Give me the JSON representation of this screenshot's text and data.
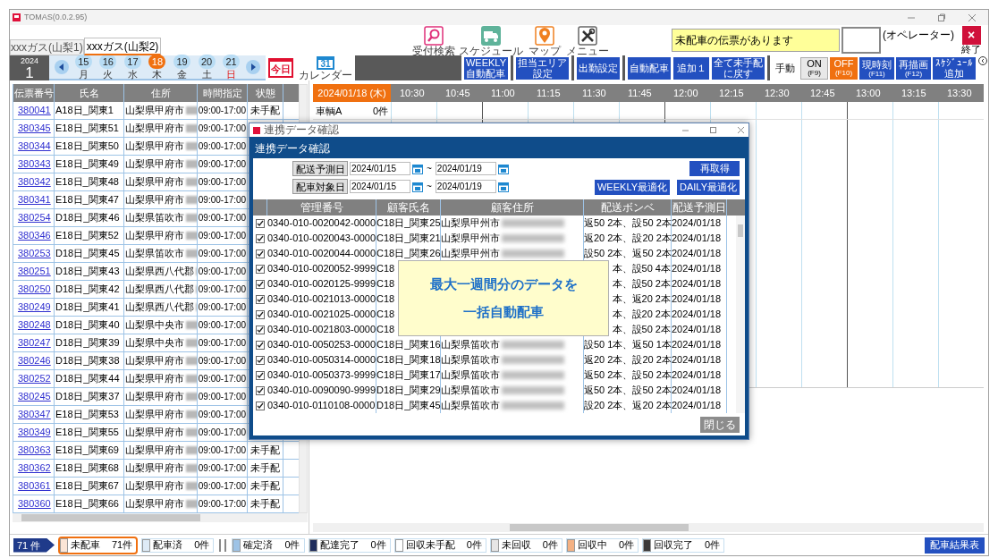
{
  "window": {
    "title": "TOMAS(0.0.2.95)"
  },
  "tabs": [
    {
      "label": "xxxガス(山梨1)",
      "selected": false
    },
    {
      "label": "xxxガス(山梨2)",
      "selected": true
    }
  ],
  "toolbar_icons": [
    {
      "kind": "search",
      "label": "受付検索"
    },
    {
      "kind": "schedule",
      "label": "スケジュール"
    },
    {
      "kind": "map",
      "label": "マップ"
    },
    {
      "kind": "menu",
      "label": "メニュー"
    }
  ],
  "notice": "未配車の伝票があります",
  "operator": "(オペレーター)",
  "exit": {
    "icon": "×",
    "label": "終了"
  },
  "calendar": {
    "year": "2024",
    "month": "1",
    "today": "今日",
    "calendar_day": "31",
    "calendar_label": "カレンダー",
    "days": [
      {
        "day": "15",
        "weekday": "月",
        "selected": false
      },
      {
        "day": "16",
        "weekday": "火",
        "selected": false
      },
      {
        "day": "17",
        "weekday": "水",
        "selected": false
      },
      {
        "day": "18",
        "weekday": "木",
        "selected": true
      },
      {
        "day": "19",
        "weekday": "金",
        "selected": false
      },
      {
        "day": "20",
        "weekday": "土",
        "selected": false
      },
      {
        "day": "21",
        "weekday": "日",
        "selected": false
      }
    ]
  },
  "action_groups": [
    [
      {
        "lines": [
          "WEEKLY",
          "自動配車"
        ]
      }
    ],
    [
      {
        "lines": [
          "担当エリア",
          "設定"
        ]
      }
    ],
    [
      {
        "lines": [
          "出勤設定"
        ]
      }
    ],
    [
      {
        "lines": [
          "自動配車"
        ]
      },
      {
        "lines": [
          "追加１"
        ]
      },
      {
        "lines": [
          "全て未手配",
          "に戻す"
        ]
      }
    ]
  ],
  "manual": {
    "label": "手動",
    "modes": [
      {
        "label": "ON",
        "key": "(F9)",
        "selected": false
      },
      {
        "label": "OFF",
        "key": "(F10)",
        "selected": true
      }
    ]
  },
  "tools": [
    {
      "lines": [
        "現時刻"
      ],
      "key": "(F11)"
    },
    {
      "lines": [
        "再描画"
      ],
      "key": "(F12)"
    },
    {
      "lines": [
        "ｽｹｼﾞｭｰﾙ",
        "追加"
      ]
    }
  ],
  "slips": {
    "columns": [
      "伝票番号",
      "氏名",
      "住所",
      "時間指定",
      "状態"
    ],
    "rows": [
      {
        "number": "380041",
        "name": "A18日_関東1",
        "address": "山梨県甲府市",
        "time": "09:00-17:00",
        "status": "未手配"
      },
      {
        "number": "380345",
        "name": "E18日_関東51",
        "address": "山梨県甲府市",
        "time": "09:00-17:00"
      },
      {
        "number": "380344",
        "name": "E18日_関東50",
        "address": "山梨県甲府市",
        "time": "09:00-17:00"
      },
      {
        "number": "380343",
        "name": "E18日_関東49",
        "address": "山梨県甲府市",
        "time": "09:00-17:00"
      },
      {
        "number": "380342",
        "name": "E18日_関東48",
        "address": "山梨県甲府市",
        "time": "09:00-17:00"
      },
      {
        "number": "380341",
        "name": "E18日_関東47",
        "address": "山梨県甲府市",
        "time": "09:00-17:00"
      },
      {
        "number": "380254",
        "name": "D18日_関東46",
        "address": "山梨県笛吹市",
        "time": "09:00-17:00"
      },
      {
        "number": "380346",
        "name": "E18日_関東52",
        "address": "山梨県甲府市",
        "time": "09:00-17:00"
      },
      {
        "number": "380253",
        "name": "D18日_関東45",
        "address": "山梨県笛吹市",
        "time": "09:00-17:00"
      },
      {
        "number": "380251",
        "name": "D18日_関東43",
        "address": "山梨県西八代郡",
        "time": "09:00-17:00"
      },
      {
        "number": "380250",
        "name": "D18日_関東42",
        "address": "山梨県西八代郡",
        "time": "09:00-17:00"
      },
      {
        "number": "380249",
        "name": "D18日_関東41",
        "address": "山梨県西八代郡",
        "time": "09:00-17:00"
      },
      {
        "number": "380248",
        "name": "D18日_関東40",
        "address": "山梨県中央市",
        "time": "09:00-17:00"
      },
      {
        "number": "380247",
        "name": "D18日_関東39",
        "address": "山梨県中央市",
        "time": "09:00-17:00"
      },
      {
        "number": "380246",
        "name": "D18日_関東38",
        "address": "山梨県甲府市",
        "time": "09:00-17:00"
      },
      {
        "number": "380252",
        "name": "D18日_関東44",
        "address": "山梨県甲府市",
        "time": "09:00-17:00"
      },
      {
        "number": "380245",
        "name": "D18日_関東37",
        "address": "山梨県甲府市",
        "time": "09:00-17:00"
      },
      {
        "number": "380347",
        "name": "E18日_関東53",
        "address": "山梨県甲府市",
        "time": "09:00-17:00"
      },
      {
        "number": "380349",
        "name": "E18日_関東55",
        "address": "山梨県甲府市",
        "time": "09:00-17:00"
      },
      {
        "number": "380363",
        "name": "E18日_関東69",
        "address": "山梨県甲府市",
        "time": "09:00-17:00",
        "status": "未手配"
      },
      {
        "number": "380362",
        "name": "E18日_関東68",
        "address": "山梨県甲府市",
        "time": "09:00-17:00",
        "status": "未手配"
      },
      {
        "number": "380361",
        "name": "E18日_関東67",
        "address": "山梨県甲府市",
        "time": "09:00-17:00",
        "status": "未手配"
      },
      {
        "number": "380360",
        "name": "E18日_関東66",
        "address": "山梨県甲府市",
        "time": "09:00-17:00",
        "status": "未手配"
      }
    ]
  },
  "timeline": {
    "date": "2024/01/18 (木)",
    "times": [
      "10:30",
      "10:45",
      "11:00",
      "11:15",
      "11:30",
      "11:45",
      "12:00",
      "12:15",
      "12:30",
      "12:45",
      "13:00",
      "13:15",
      "13:30"
    ],
    "vehicles": [
      {
        "name": "車輌A",
        "count": "0件"
      }
    ]
  },
  "dialog": {
    "title": "連携データ確認",
    "heading": "連携データ確認",
    "filters": [
      {
        "label": "配送予測日",
        "from": "2024/01/15",
        "separator": "~",
        "to": "2024/01/19"
      },
      {
        "label": "配車対象日",
        "from": "2024/01/15",
        "separator": "~",
        "to": "2024/01/19"
      }
    ],
    "buttons": {
      "refetch": "再取得",
      "weekly": "WEEKLY最適化",
      "daily": "DAILY最適化",
      "close": "閉じる"
    },
    "columns": [
      "管理番号",
      "顧客氏名",
      "顧客住所",
      "配送ボンベ",
      "配送予測日"
    ],
    "rows": [
      {
        "checked": true,
        "id": "0340-010-0020042-0000",
        "name": "C18日_関東25",
        "address": "山梨県甲州市",
        "cylinders": "返50 2本、設50 2本",
        "date": "2024/01/18"
      },
      {
        "checked": true,
        "id": "0340-010-0020043-0000",
        "name": "C18日_関東21",
        "address": "山梨県甲州市",
        "cylinders": "返20 2本、設20 2本",
        "date": "2024/01/18"
      },
      {
        "checked": true,
        "id": "0340-010-0020044-0000",
        "name": "C18日_関東26",
        "address": "山梨県甲州市",
        "cylinders": "設50 2本、返50 2本",
        "date": "2024/01/18"
      },
      {
        "checked": true,
        "id": "0340-010-0020052-9999",
        "name": "C18",
        "cylinders": "本、設50 4本",
        "date": "2024/01/18"
      },
      {
        "checked": true,
        "id": "0340-010-0020125-9999",
        "name": "C18",
        "cylinders": "本、設50 2本",
        "date": "2024/01/18"
      },
      {
        "checked": true,
        "id": "0340-010-0021013-0000",
        "name": "C18",
        "cylinders": "本、返20 2本",
        "date": "2024/01/18"
      },
      {
        "checked": true,
        "id": "0340-010-0021025-0000",
        "name": "C18",
        "cylinders": "本、設20 2本",
        "date": "2024/01/18"
      },
      {
        "checked": true,
        "id": "0340-010-0021803-0000",
        "name": "C18",
        "cylinders": "本、設50 2本",
        "date": "2024/01/18"
      },
      {
        "checked": true,
        "id": "0340-010-0050253-0000",
        "name": "C18日_関東16",
        "address": "山梨県笛吹市",
        "cylinders": "設50 1本、返50 1本",
        "date": "2024/01/18"
      },
      {
        "checked": true,
        "id": "0340-010-0050314-0000",
        "name": "C18日_関東18",
        "address": "山梨県笛吹市",
        "cylinders": "返20 2本、設20 2本",
        "date": "2024/01/18"
      },
      {
        "checked": true,
        "id": "0340-010-0050373-9999",
        "name": "C18日_関東17",
        "address": "山梨県笛吹市",
        "cylinders": "返50 2本、設50 2本",
        "date": "2024/01/18"
      },
      {
        "checked": true,
        "id": "0340-010-0090090-9999",
        "name": "D18日_関東29",
        "address": "山梨県笛吹市",
        "cylinders": "返50 2本、設50 2本",
        "date": "2024/01/18"
      },
      {
        "checked": true,
        "id": "0340-010-0110108-0000",
        "name": "D18日_関東45",
        "address": "山梨県笛吹市",
        "cylinders": "設20 2本、返20 2本",
        "date": "2024/01/18"
      }
    ]
  },
  "callout": {
    "lines": [
      "最大一週間分のデータを",
      "一括自動配車"
    ]
  },
  "status_bar": {
    "total": "71 件",
    "items": [
      {
        "label": "未配車",
        "count": "71件",
        "color": "#fbe5d6",
        "selected": true
      },
      {
        "label": "配車済",
        "count": "0件",
        "color": "#deebf7",
        "selected": false
      },
      {
        "label": "確定済",
        "count": "0件",
        "color": "#9dc3e6",
        "selected": false
      },
      {
        "label": "配達完了",
        "count": "0件",
        "color": "#1f2d5c",
        "selected": false
      },
      {
        "label": "回収未手配",
        "count": "0件",
        "color": "#ffffff",
        "selected": false
      },
      {
        "label": "未回収",
        "count": "0件",
        "color": "#e7e6e6",
        "selected": false
      },
      {
        "label": "回収中",
        "count": "0件",
        "color": "#f4b183",
        "selected": false
      },
      {
        "label": "回収完了",
        "count": "0件",
        "color": "#3b3838",
        "selected": false
      }
    ],
    "report_button": "配車結果表"
  }
}
